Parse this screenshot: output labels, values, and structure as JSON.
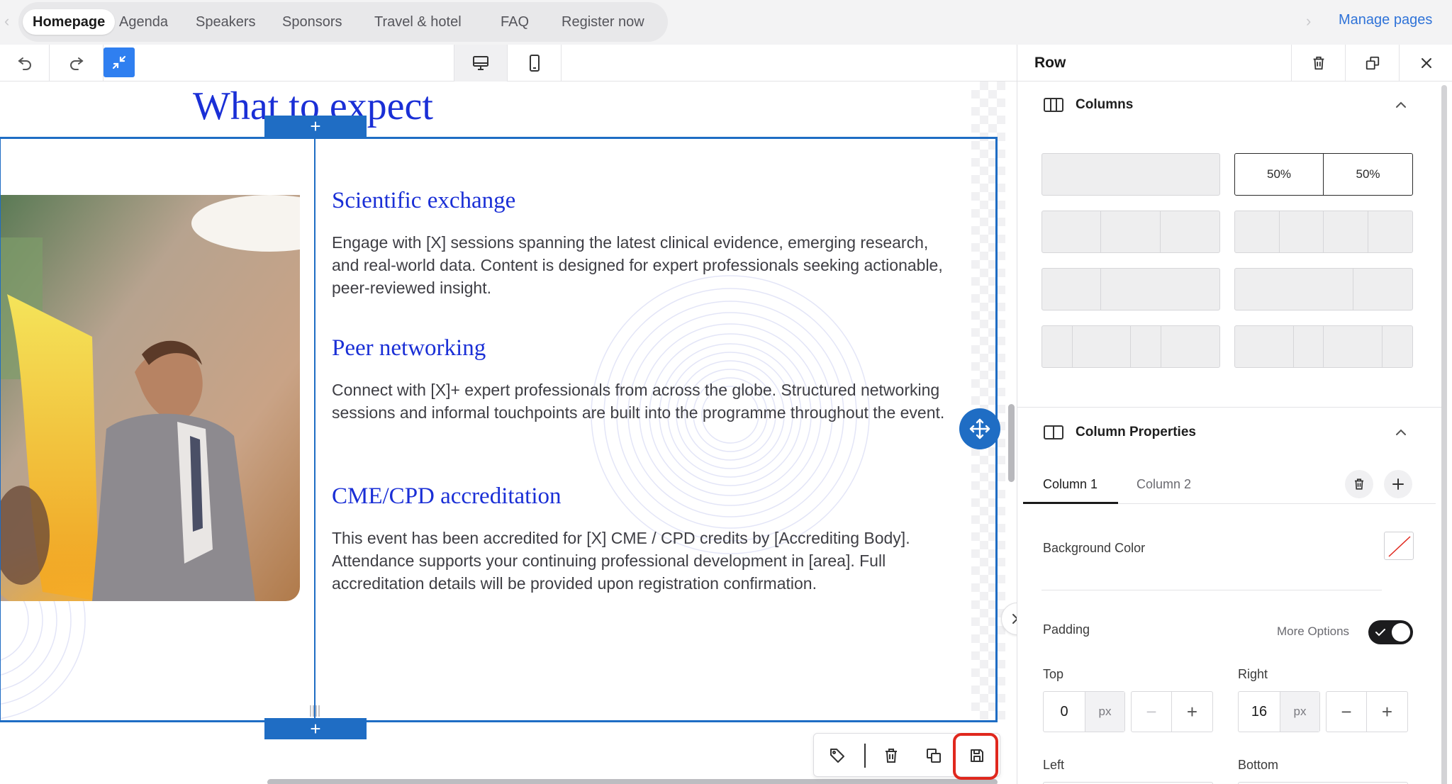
{
  "nav": {
    "tabs": [
      {
        "label": "Homepage"
      },
      {
        "label": "Agenda"
      },
      {
        "label": "Speakers"
      },
      {
        "label": "Sponsors"
      },
      {
        "label": "Travel & hotel"
      },
      {
        "label": "FAQ"
      },
      {
        "label": "Register now"
      }
    ],
    "active_tab": "Homepage",
    "manage_pages": "Manage pages"
  },
  "toolbar": {
    "icons": [
      "undo-icon",
      "redo-icon",
      "collapse-icon",
      "desktop-icon",
      "mobile-icon"
    ],
    "active_device": "desktop"
  },
  "canvas": {
    "heading": "What to expect",
    "features": [
      {
        "title": "Scientific exchange",
        "body": "Engage with [X] sessions spanning the latest clinical evidence, emerging research, and real-world data. Content is designed for expert professionals seeking actionable, peer-reviewed insight."
      },
      {
        "title": "Peer networking",
        "body": "Connect with [X]+ expert professionals from across the globe. Structured networking sessions and informal touchpoints are built into the programme throughout the event."
      },
      {
        "title": "CME/CPD accreditation",
        "body": "This event has been accredited for [X] CME / CPD credits by [Accrediting Body]. Attendance supports your continuing professional development in [area]. Full accreditation details will be provided upon registration confirmation."
      }
    ],
    "add_symbol": "+",
    "action_bar": [
      "tag-icon",
      "trash-icon",
      "duplicate-icon",
      "save-icon"
    ],
    "colors": {
      "accent": "#1f6dc4",
      "heading": "#1a2fd6",
      "highlight": "#e0281e"
    }
  },
  "panel": {
    "title": "Row",
    "columns_section": {
      "title": "Columns",
      "selected_layout_labels": [
        "50%",
        "50%"
      ]
    },
    "column_properties": {
      "title": "Column Properties",
      "tabs": [
        "Column 1",
        "Column 2"
      ],
      "active_tab": "Column 1",
      "background_color_label": "Background Color",
      "padding_label": "Padding",
      "more_options_label": "More Options",
      "more_options_on": true,
      "top_label": "Top",
      "top_value": "0",
      "right_label": "Right",
      "right_value": "16",
      "unit": "px",
      "left_label": "Left",
      "bottom_label": "Bottom"
    }
  }
}
